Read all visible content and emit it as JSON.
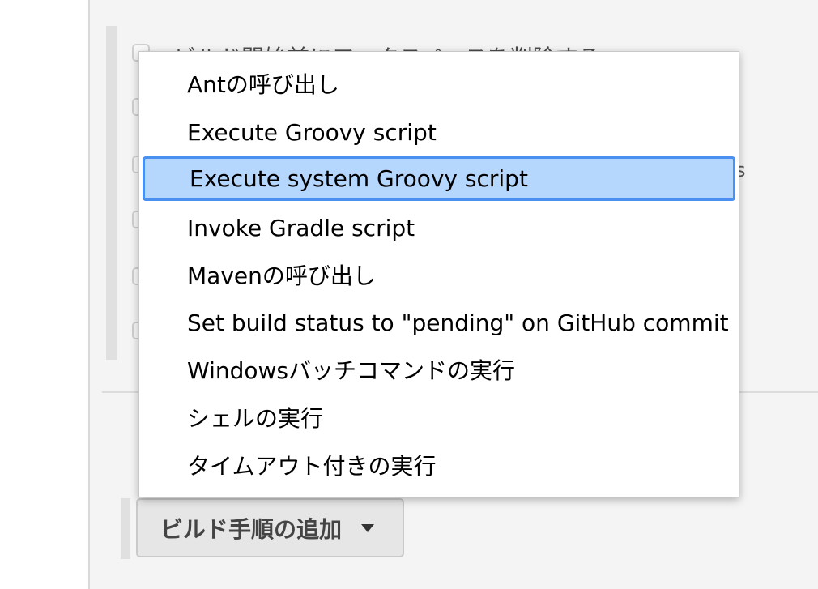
{
  "background_option_text": "ビルド開始前にワークスペースを削除する",
  "peeking_text": "s",
  "menu": {
    "items": [
      {
        "label": "Antの呼び出し"
      },
      {
        "label": "Execute Groovy script"
      },
      {
        "label": "Execute system Groovy script",
        "selected": true
      },
      {
        "label": "Invoke Gradle script"
      },
      {
        "label": "Mavenの呼び出し"
      },
      {
        "label": "Set build status to \"pending\" on GitHub commit"
      },
      {
        "label": "Windowsバッチコマンドの実行"
      },
      {
        "label": "シェルの実行"
      },
      {
        "label": "タイムアウト付きの実行"
      }
    ]
  },
  "add_build_step_button": {
    "label": "ビルド手順の追加",
    "icon": "caret-down-icon"
  },
  "colors": {
    "selected_bg": "#b5d6fd",
    "selected_border": "#4a90f0"
  }
}
